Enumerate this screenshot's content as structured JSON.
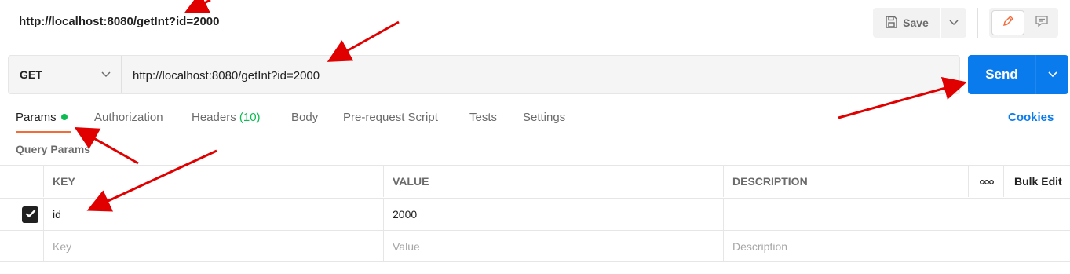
{
  "header": {
    "title": "http://localhost:8080/getInt?id=2000",
    "save_label": "Save"
  },
  "icons": {
    "save": "save-icon",
    "caret": "chevron-down-icon",
    "edit": "pencil-icon",
    "comment": "comment-icon",
    "more": "more-horizontal-icon",
    "check": "check-icon"
  },
  "request": {
    "method": "GET",
    "url": "http://localhost:8080/getInt?id=2000",
    "send_label": "Send"
  },
  "tabs": [
    {
      "label": "Params",
      "active": true,
      "indicator": true
    },
    {
      "label": "Authorization"
    },
    {
      "label": "Headers",
      "count": "(10)"
    },
    {
      "label": "Body"
    },
    {
      "label": "Pre-request Script"
    },
    {
      "label": "Tests"
    },
    {
      "label": "Settings"
    }
  ],
  "cookies_label": "Cookies",
  "query_params": {
    "section_label": "Query Params",
    "columns": {
      "key": "KEY",
      "value": "VALUE",
      "description": "DESCRIPTION",
      "bulk_edit": "Bulk Edit"
    },
    "rows": [
      {
        "checked": true,
        "key": "id",
        "value": "2000",
        "description": ""
      }
    ],
    "placeholders": {
      "key": "Key",
      "value": "Value",
      "description": "Description"
    }
  },
  "colors": {
    "accent_blue": "#097bed",
    "active_tab_underline": "#f26b3a",
    "status_green": "#0cbb52",
    "annotation_red": "#e00000"
  }
}
